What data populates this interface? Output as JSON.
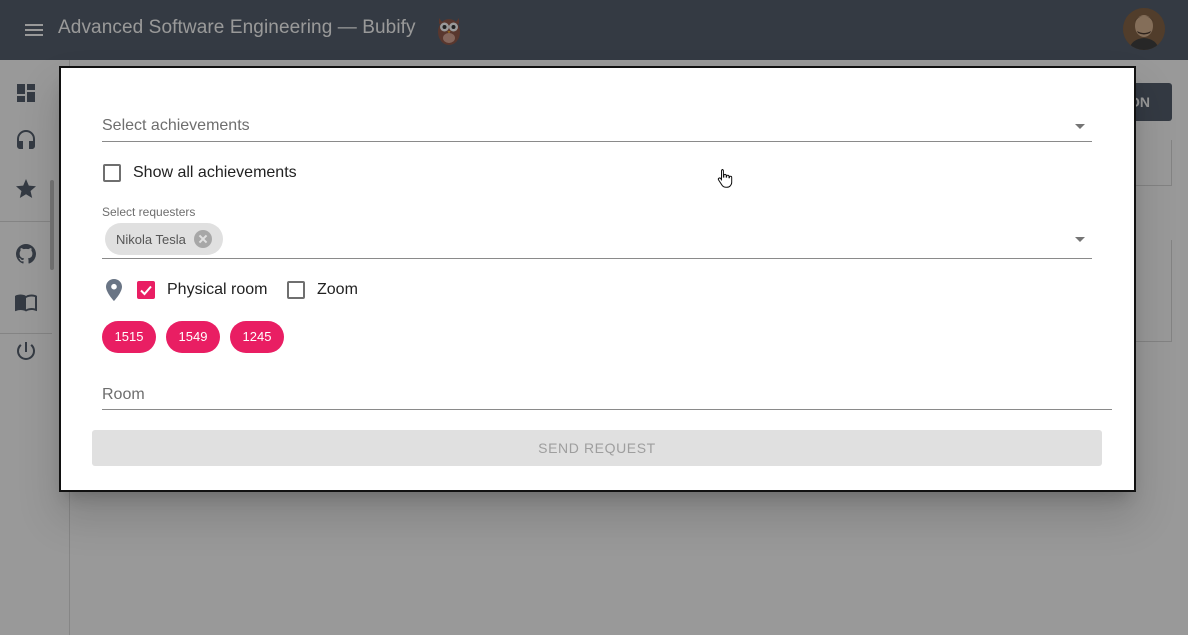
{
  "appbar": {
    "title": "Advanced Software Engineering — Bubify",
    "menu_icon": "menu-icon",
    "logo_icon": "owl-icon",
    "avatar_icon": "user-avatar",
    "color": "#455160"
  },
  "sidebar": {
    "items": [
      {
        "icon": "dashboard-icon"
      },
      {
        "icon": "headset-icon"
      },
      {
        "icon": "star-icon"
      },
      {
        "icon": "github-icon"
      },
      {
        "icon": "book-icon"
      },
      {
        "icon": "power-icon"
      }
    ]
  },
  "background": {
    "button_label": "ON"
  },
  "dialog": {
    "achievements_placeholder": "Select achievements",
    "show_all_label": "Show all achievements",
    "show_all_checked": false,
    "requesters_label": "Select requesters",
    "requesters": [
      "Nikola Tesla"
    ],
    "location_icon": "location-pin-icon",
    "physical_room_label": "Physical room",
    "physical_room_checked": true,
    "zoom_label": "Zoom",
    "zoom_checked": false,
    "rooms": [
      "1515",
      "1549",
      "1245"
    ],
    "room_field_placeholder": "Room",
    "send_button_label": "SEND REQUEST",
    "accent_color": "#e91e63"
  }
}
